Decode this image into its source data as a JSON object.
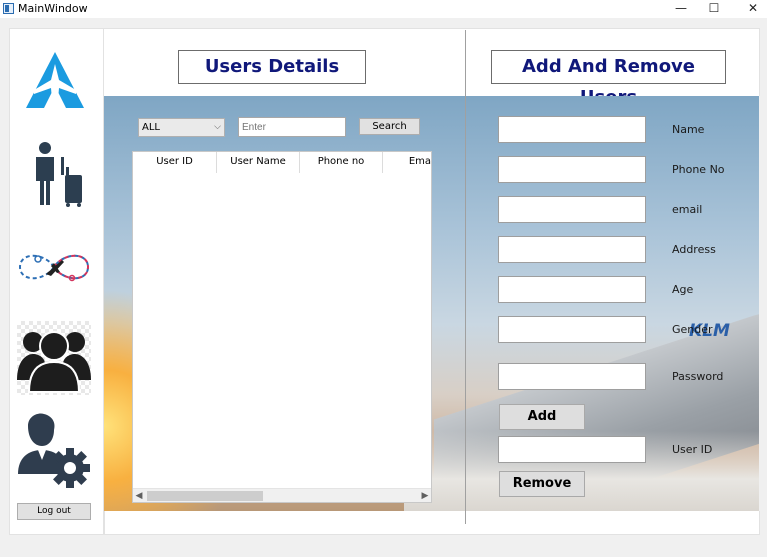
{
  "window": {
    "title": "MainWindow",
    "controls": {
      "minimize": "—",
      "maximize": "☐",
      "close": "✕"
    }
  },
  "sidebar": {
    "items": [
      {
        "icon": "airline-logo-icon"
      },
      {
        "icon": "traveler-luggage-icon"
      },
      {
        "icon": "flight-route-icon"
      },
      {
        "icon": "users-group-icon"
      },
      {
        "icon": "admin-settings-icon"
      }
    ],
    "logout_label": "Log out"
  },
  "users_panel": {
    "title": "Users Details",
    "filter": {
      "selected": "ALL"
    },
    "search_input": {
      "placeholder": "Enter"
    },
    "search_label": "Search",
    "table": {
      "columns": [
        "User ID",
        "User Name",
        "Phone no",
        "Ema"
      ],
      "rows": []
    }
  },
  "manage_panel": {
    "title": "Add And Remove Users",
    "fields": [
      {
        "label": "Name",
        "value": ""
      },
      {
        "label": "Phone No",
        "value": ""
      },
      {
        "label": "email",
        "value": ""
      },
      {
        "label": "Address",
        "value": ""
      },
      {
        "label": "Age",
        "value": ""
      },
      {
        "label": "Gender",
        "value": ""
      },
      {
        "label": "Password",
        "value": ""
      }
    ],
    "add_label": "Add",
    "user_id_field": {
      "label": "User ID",
      "value": ""
    },
    "remove_label": "Remove"
  },
  "background": {
    "logo_text": "KLM"
  },
  "colors": {
    "heading_text": "#10187a",
    "brand_blue": "#1b9be0",
    "icon_dark": "#2c3e50"
  }
}
